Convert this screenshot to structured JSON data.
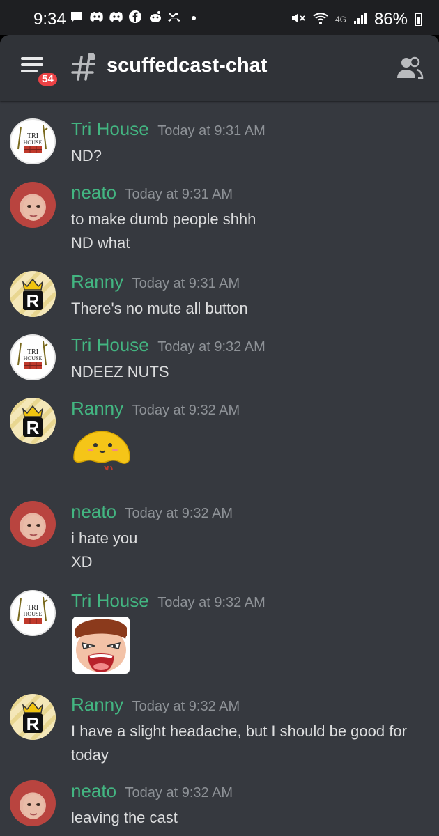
{
  "status_bar": {
    "time": "9:34",
    "notification_icons": [
      "chat-icon",
      "discord-icon",
      "discord-icon",
      "facebook-icon",
      "reddit-icon",
      "missed-call-icon",
      "dot-icon"
    ],
    "signal_label": "4G",
    "battery": "86%"
  },
  "header": {
    "menu_badge": "54",
    "channel_name": "scuffedcast-chat"
  },
  "messages": [
    {
      "author": "Tri House",
      "time": "Today at 9:31 AM",
      "avatar": "tri-house",
      "lines": [
        "ND?"
      ]
    },
    {
      "author": "neato",
      "time": "Today at 9:31 AM",
      "avatar": "neato",
      "lines": [
        "to make dumb people shhh",
        "ND what"
      ]
    },
    {
      "author": "Ranny",
      "time": "Today at 9:31 AM",
      "avatar": "ranny",
      "lines": [
        "There's no mute all button"
      ]
    },
    {
      "author": "Tri House",
      "time": "Today at 9:32 AM",
      "avatar": "tri-house",
      "lines": [
        "NDEEZ NUTS"
      ]
    },
    {
      "author": "Ranny",
      "time": "Today at 9:32 AM",
      "avatar": "ranny",
      "emote": "yellow-blob-emote"
    },
    {
      "author": "neato",
      "time": "Today at 9:32 AM",
      "avatar": "neato",
      "lines": [
        "i hate you",
        "XD"
      ]
    },
    {
      "author": "Tri House",
      "time": "Today at 9:32 AM",
      "avatar": "tri-house",
      "emote": "laughing-face-emote"
    },
    {
      "author": "Ranny",
      "time": "Today at 9:32 AM",
      "avatar": "ranny",
      "lines": [
        "I have a slight headache, but I should be good for",
        "today"
      ]
    },
    {
      "author": "neato",
      "time": "Today at 9:32 AM",
      "avatar": "neato",
      "lines": [
        "leaving the cast"
      ]
    }
  ],
  "avatar_text": {
    "tri_house_line1": "TRI",
    "tri_house_line2": "HOUSE",
    "ranny_letter": "R"
  },
  "colors": {
    "username": "#43b581",
    "timestamp": "#8e9297",
    "background": "#36393f",
    "header": "#303338",
    "badge": "#ed4245"
  }
}
